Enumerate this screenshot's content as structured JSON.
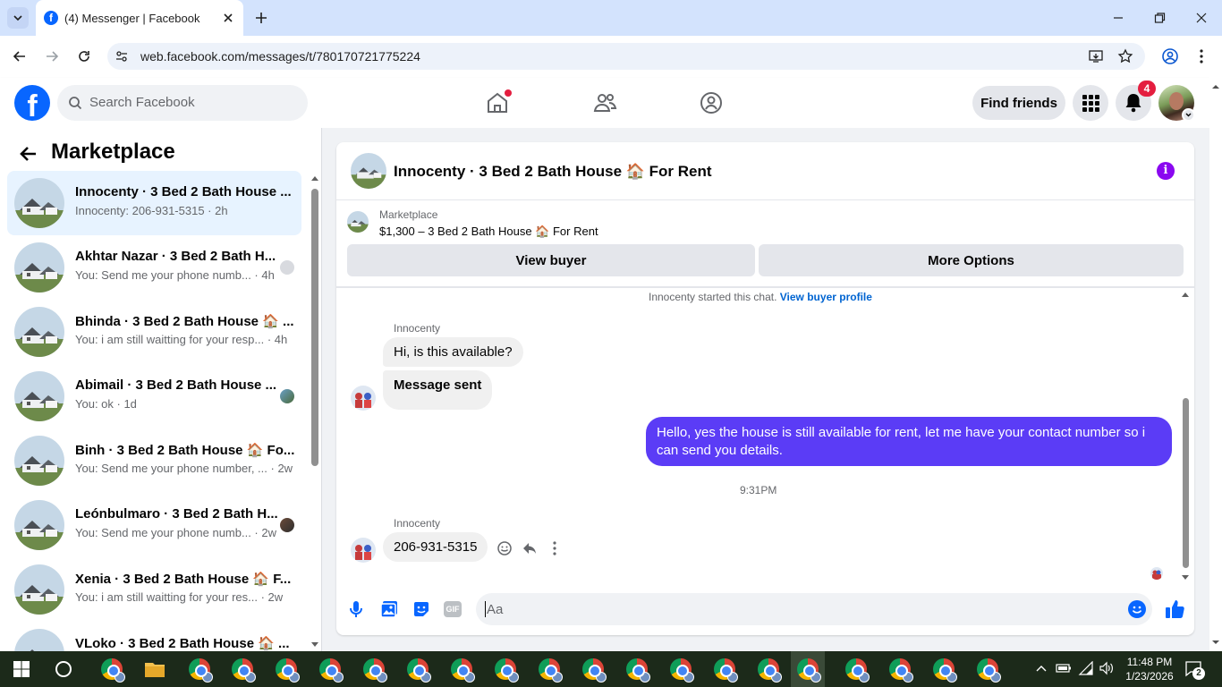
{
  "browser": {
    "tab_title": "(4) Messenger | Facebook",
    "url": "web.facebook.com/messages/t/780170721775224"
  },
  "header": {
    "search_placeholder": "Search Facebook",
    "find_friends": "Find friends",
    "notification_count": "4",
    "brand_color": "#0866ff"
  },
  "sidebar": {
    "title": "Marketplace",
    "conversations": [
      {
        "name": "Innocenty · 3 Bed 2 Bath House ...",
        "preview": "Innocenty: 206-931-5315 · 2h",
        "selected": true
      },
      {
        "name": "Akhtar Nazar · 3 Bed 2 Bath H...",
        "preview": "You: Send me your phone numb... · 4h"
      },
      {
        "name": "Bhinda · 3 Bed 2 Bath House 🏠 ...",
        "preview": "You: i am still waitting for your resp... · 4h"
      },
      {
        "name": "Abimail · 3 Bed 2 Bath House ...",
        "preview": "You: ok · 1d"
      },
      {
        "name": "Binh · 3 Bed 2 Bath House 🏠 Fo...",
        "preview": "You: Send me your phone number, ... · 2w"
      },
      {
        "name": "Leónbulmaro · 3 Bed 2 Bath H...",
        "preview": "You: Send me your phone numb... · 2w"
      },
      {
        "name": "Xenia · 3 Bed 2 Bath House 🏠 F...",
        "preview": "You: i am still waitting for your res... · 2w"
      },
      {
        "name": "VLoko · 3 Bed 2 Bath House 🏠 ...",
        "preview": ""
      }
    ]
  },
  "chat": {
    "title": "Innocenty · 3 Bed 2 Bath House 🏠 For Rent",
    "listing_label": "Marketplace",
    "listing_detail": "$1,300 – 3 Bed 2 Bath House 🏠 For Rent",
    "view_buyer": "View buyer",
    "more_options": "More Options",
    "started_text": "Innocenty started this chat.",
    "buyer_profile_link": "View buyer profile",
    "sender_name": "Innocenty",
    "msg1": "Hi, is this available?",
    "msg2": "Message sent",
    "msg_outgoing": "Hello, yes the house is still available for rent, let me have your contact number so i can send you  details.",
    "timestamp": "9:31PM",
    "sender_name2": "Innocenty",
    "msg3": "206-931-5315",
    "composer_placeholder": "Aa",
    "outgoing_color": "#5b3cf6"
  },
  "taskbar": {
    "time": "11:48 PM",
    "date": "1/23/2026",
    "notif_count": "2"
  }
}
